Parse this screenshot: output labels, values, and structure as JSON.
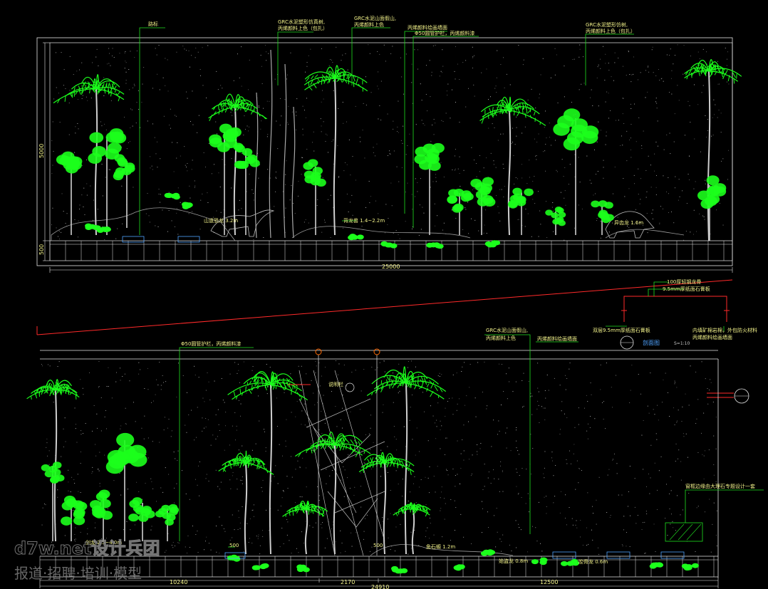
{
  "colors": {
    "frame": "#e6e6e6",
    "leader": "#20e020",
    "foliage": "#1cff1c",
    "trunk": "#cfcfcf",
    "label": "#f2f28a",
    "cut_line": "#ff2a2a",
    "section_mark": "#4fa3ff"
  },
  "upper_elevation": {
    "labels": {
      "top_1": "路标",
      "top_2a": "GRC水泥塑形仿真树,",
      "top_2b": "丙烯颜料上色（包扎）",
      "top_3a": "GRC水泥山面假山,",
      "top_3b": "丙烯颜料上色",
      "top_4": "丙烯颜料绘画墙面",
      "top_5": "Φ50圆管护栏，丙烯颜料漆",
      "top_6a": "GRC水泥塑形仿树,",
      "top_6b": "丙烯颜料上色（包扎）",
      "ann_1": "山道恐龙 3.2m",
      "ann_2": "背龙兽 1.4~2.2m",
      "ann_3": "异齿龙 1.6m"
    },
    "dims": {
      "height": "5000",
      "base": "500",
      "total_width": "25000"
    }
  },
  "lower_elevation": {
    "labels": {
      "top_1": "Φ50圆管护栏，丙烯颜料漆",
      "top_2a": "GRC水泥山面假山,",
      "top_2b": "丙烯颜料上色",
      "top_3": "丙烯颜料绘画墙面",
      "tree_tag": "说明栏",
      "ann_1": "剑龙 2.5~4.0m",
      "ann_2": "鱼石螈 1.2m",
      "ann_3": "始盗龙 0.8m",
      "ann_4": "腔骨龙 0.6m",
      "right_note": "窗框边缘由大理石专题设计一套",
      "base_dim": "500",
      "base_dim_2": "500"
    },
    "dims": {
      "seg_1": "10240",
      "seg_2": "2170",
      "seg_3": "12500",
      "total_width": "24910"
    }
  },
  "section_detail": {
    "label_a": "100厚轻钢龙骨",
    "label_b": "9.5mm厚纸面石膏板",
    "label_c": "双层9.5mm厚纸面石膏板",
    "label_d": "内填矿棉岩棉，外包防火材料",
    "label_d2": "丙烯颜料绘画墙面",
    "title": "剖面图",
    "scale": "S=1:10"
  },
  "watermark": {
    "line_1": "d7w.net设计兵团",
    "line_2": "报道·招聘·培训·模型"
  }
}
